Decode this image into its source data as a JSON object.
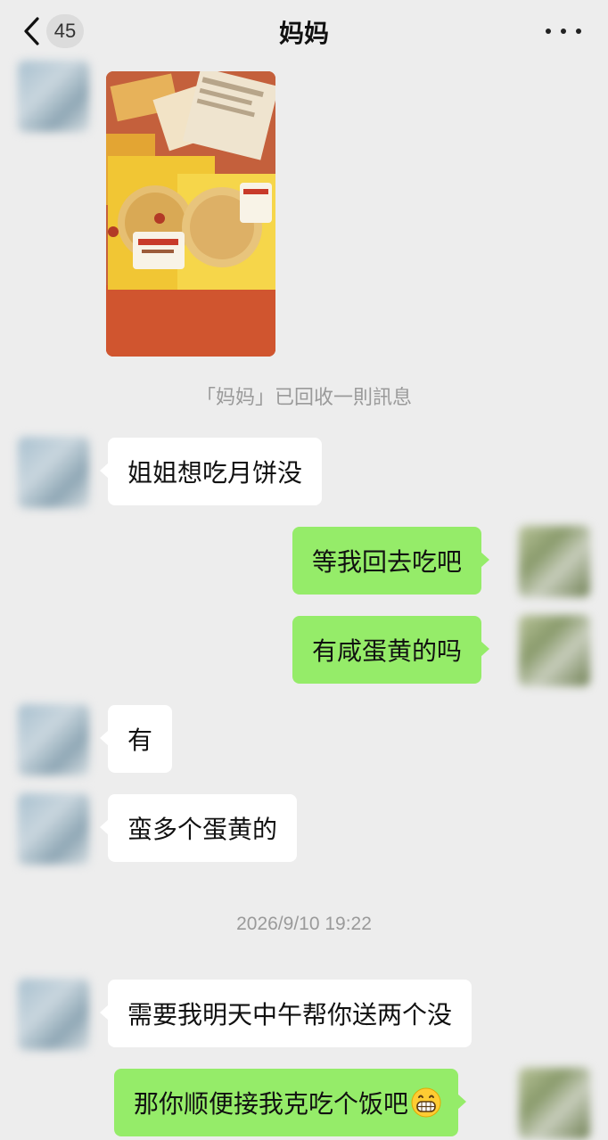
{
  "header": {
    "back_label": "back",
    "unread_count": "45",
    "title": "妈妈",
    "more_label": "more"
  },
  "messages": {
    "recalled_notice": "「妈妈」已回收一則訊息",
    "m1": "姐姐想吃月饼没",
    "m2": "等我回去吃吧",
    "m3": "有咸蛋黄的吗",
    "m4": "有",
    "m5": "蛮多个蛋黄的",
    "timestamp": "2026/9/10 19:22",
    "m6": "需要我明天中午帮你送两个没",
    "m7": "那你顺便接我克吃个饭吧",
    "m7_emoji": "grinning-face-emoji"
  },
  "colors": {
    "background": "#EDEDED",
    "outgoing_bubble": "#95EC69",
    "incoming_bubble": "#FFFFFF",
    "system_text": "#9A9A9A"
  }
}
